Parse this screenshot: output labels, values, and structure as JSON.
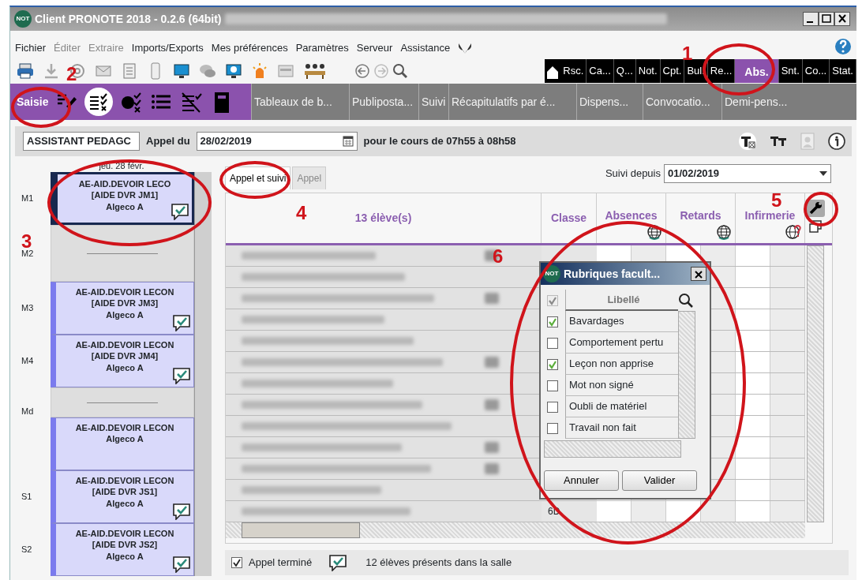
{
  "window": {
    "logo": "NOT",
    "title": "Client PRONOTE 2018 - 0.2.6 (64bit)"
  },
  "menu": [
    {
      "label": "Fichier",
      "disabled": false
    },
    {
      "label": "Éditer",
      "disabled": true
    },
    {
      "label": "Extraire",
      "disabled": true
    },
    {
      "label": "Imports/Exports",
      "disabled": false
    },
    {
      "label": "Mes préférences",
      "disabled": false
    },
    {
      "label": "Paramètres",
      "disabled": false
    },
    {
      "label": "Serveur",
      "disabled": false
    },
    {
      "label": "Assistance",
      "disabled": false
    }
  ],
  "module_tabs": [
    {
      "label": "Rsc.",
      "selected": false
    },
    {
      "label": "Ca...",
      "selected": false
    },
    {
      "label": "Q...",
      "selected": false
    },
    {
      "label": "Not.",
      "selected": false
    },
    {
      "label": "Cpt.",
      "selected": false
    },
    {
      "label": "Bul.",
      "selected": false
    },
    {
      "label": "Re...",
      "selected": false
    },
    {
      "label": "Abs.",
      "selected": true
    },
    {
      "label": "Snt.",
      "selected": false
    },
    {
      "label": "Co...",
      "selected": false
    },
    {
      "label": "Stat.",
      "selected": false
    }
  ],
  "view_label": "Saisie",
  "view_icons": [
    {
      "kind": "pencil",
      "selected": false
    },
    {
      "kind": "checklist",
      "selected": true
    },
    {
      "kind": "pie",
      "selected": false
    },
    {
      "kind": "list",
      "selected": false
    },
    {
      "kind": "crossed",
      "selected": false
    },
    {
      "kind": "notebook",
      "selected": false
    }
  ],
  "subtabs": [
    "Tableaux de b...",
    "Publiposta...",
    "Suivi",
    "Récapitulatifs par é...",
    "Dispens...",
    "Convocatio...",
    "Demi-pens..."
  ],
  "filter_bar": {
    "person": "ASSISTANT PEDAGC",
    "date_label": "Appel du",
    "date": "28/02/2019",
    "course_time": "pour le cours de 07h55 à 08h58"
  },
  "schedule": {
    "day": "jeu. 28 févr.",
    "blocks": [
      {
        "kind": "course",
        "slot": "M1",
        "lines": [
          "AE-AID.DEVOIR LECO",
          "[AIDE DVR JM1]",
          "Algeco A"
        ],
        "selected": true,
        "comment": true
      },
      {
        "kind": "break",
        "slot": "M2"
      },
      {
        "kind": "course",
        "slot": "M3",
        "lines": [
          "AE-AID.DEVOIR LECON",
          "[AIDE DVR JM3]",
          "Algeco A"
        ],
        "selected": false,
        "comment": true
      },
      {
        "kind": "course",
        "slot": "M4",
        "lines": [
          "AE-AID.DEVOIR LECON",
          "[AIDE DVR JM4]",
          "Algeco A"
        ],
        "selected": false,
        "comment": true
      },
      {
        "kind": "break",
        "slot": "Md"
      },
      {
        "kind": "course",
        "lines": [
          "AE-AID.DEVOIR LECON",
          "Algeco A"
        ],
        "selected": false,
        "comment": false
      },
      {
        "kind": "course",
        "slot": "S1",
        "lines": [
          "AE-AID.DEVOIR LECON",
          "[AIDE DVR JS1]",
          "Algeco A"
        ],
        "selected": false,
        "comment": true
      },
      {
        "kind": "course",
        "slot": "S2",
        "lines": [
          "AE-AID.DEVOIR LECON",
          "[AIDE DVR JS2]",
          "Algeco A"
        ],
        "selected": false,
        "comment": true
      }
    ]
  },
  "tabs": [
    {
      "label": "Appel et suivi",
      "selected": true
    },
    {
      "label": "Appel",
      "selected": false
    }
  ],
  "follow_since": {
    "label": "Suivi depuis",
    "value": "01/02/2019"
  },
  "grid": {
    "columns": [
      "13 élève(s)",
      "Classe",
      "Absences",
      "Retards",
      "Infirmerie"
    ],
    "rows": [
      {
        "note": true
      },
      {
        "note": false
      },
      {
        "note": true
      },
      {
        "note": false
      },
      {
        "note": false
      },
      {
        "note": true
      },
      {
        "note": false
      },
      {
        "note": true
      },
      {
        "note": false
      },
      {
        "note": true
      },
      {
        "note": true
      },
      {
        "note": false
      },
      {
        "note": false,
        "class": "6D"
      }
    ]
  },
  "dialog": {
    "logo": "NOT",
    "title": "Rubriques facult...",
    "column": "Libellé",
    "select_all": {
      "checked": true,
      "disabled": true
    },
    "items": [
      {
        "label": "Bavardages",
        "checked": true
      },
      {
        "label": "Comportement pertu",
        "checked": false
      },
      {
        "label": "Leçon non apprise",
        "checked": true
      },
      {
        "label": "Mot non signé",
        "checked": false
      },
      {
        "label": "Oubli de matériel",
        "checked": false
      },
      {
        "label": "Travail non fait",
        "checked": false
      }
    ],
    "buttons": [
      "Annuler",
      "Valider"
    ]
  },
  "footer": {
    "finished_label": "Appel terminé",
    "finished": true,
    "presence": "12 élèves présents dans la salle"
  },
  "annotations": [
    "1",
    "2",
    "3",
    "4",
    "5",
    "6"
  ]
}
